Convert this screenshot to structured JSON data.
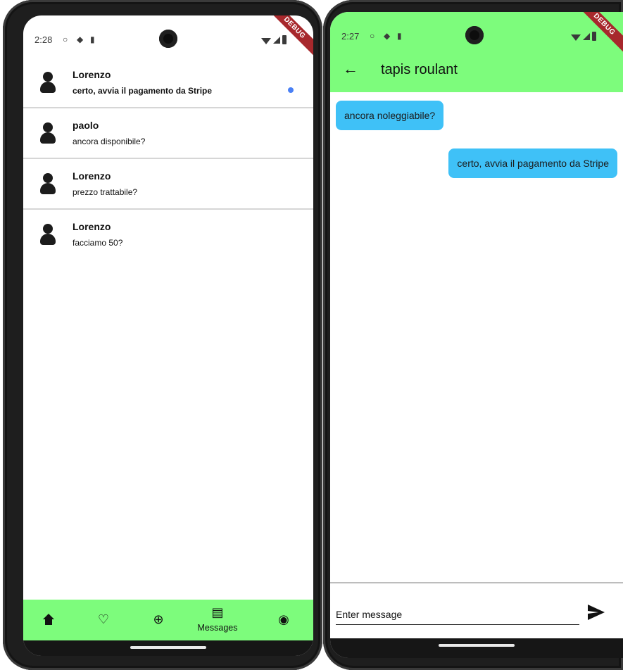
{
  "left_screen": {
    "status_bar": {
      "time": "2:28",
      "debug_banner": "DEBUG"
    },
    "conversations": [
      {
        "name": "Lorenzo",
        "last_message": "certo, avvia il pagamento da Stripe",
        "unread": true
      },
      {
        "name": "paolo",
        "last_message": "ancora disponibile?",
        "unread": false
      },
      {
        "name": "Lorenzo",
        "last_message": "prezzo trattabile?",
        "unread": false
      },
      {
        "name": "Lorenzo",
        "last_message": "facciamo 50?",
        "unread": false
      }
    ],
    "bottom_nav": {
      "items": [
        {
          "icon": "home-icon"
        },
        {
          "icon": "heart-icon"
        },
        {
          "icon": "add-circle-icon"
        },
        {
          "icon": "message-icon",
          "label": "Messages",
          "active": true
        },
        {
          "icon": "account-circle-icon"
        }
      ],
      "color": "#7dfc7c"
    }
  },
  "right_screen": {
    "status_bar": {
      "time": "2:27",
      "debug_banner": "DEBUG"
    },
    "app_bar": {
      "title": "tapis roulant",
      "color": "#7dfc7c"
    },
    "messages": [
      {
        "text": "ancora noleggiabile?",
        "side": "left"
      },
      {
        "text": "certo, avvia il pagamento da Stripe",
        "side": "right"
      }
    ],
    "composer": {
      "placeholder": "Enter message"
    },
    "bubble_color": "#3fc1f7"
  }
}
